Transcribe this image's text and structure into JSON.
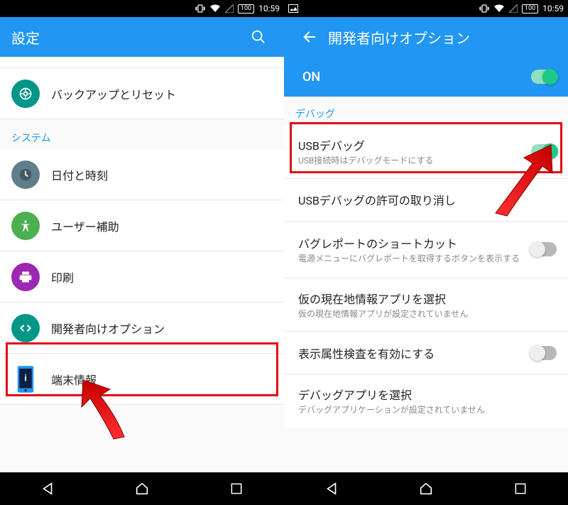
{
  "statusbar": {
    "battery": "100",
    "time": "10:59"
  },
  "left": {
    "title": "設定",
    "itemBackup": "バックアップとリセット",
    "section": "システム",
    "itemDate": "日付と時刻",
    "itemAccessibility": "ユーザー補助",
    "itemPrint": "印刷",
    "itemDev": "開発者向けオプション",
    "itemAbout": "端末情報"
  },
  "right": {
    "title": "開発者向けオプション",
    "masterLabel": "ON",
    "section": "デバッグ",
    "usbDebug": {
      "title": "USBデバッグ",
      "sub": "USB接続時はデバッグモードにする"
    },
    "usbRevoke": {
      "title": "USBデバッグの許可の取り消し"
    },
    "bugReport": {
      "title": "バグレポートのショートカット",
      "sub": "電源メニューにバグレポートを取得するボタンを表示する"
    },
    "mockLoc": {
      "title": "仮の現在地情報アプリを選択",
      "sub": "仮の現在地情報アプリが設定されていません"
    },
    "viewAttr": {
      "title": "表示属性検査を有効にする"
    },
    "debugApp": {
      "title": "デバッグアプリを選択",
      "sub": "デバッグアプリケーションが設定されていません"
    }
  }
}
